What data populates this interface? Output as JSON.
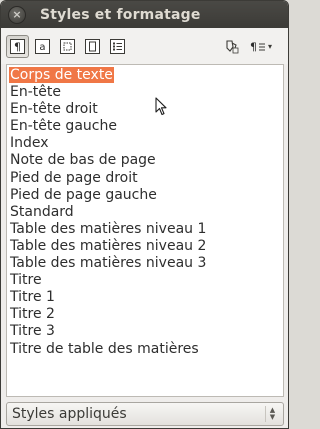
{
  "window": {
    "title": "Styles et formatage",
    "close_glyph": "×"
  },
  "toolbar": {
    "buttons": [
      {
        "icon": "paragraph-styles-icon",
        "active": true
      },
      {
        "icon": "character-styles-icon",
        "active": false
      },
      {
        "icon": "frame-styles-icon",
        "active": false
      },
      {
        "icon": "page-styles-icon",
        "active": false
      },
      {
        "icon": "list-styles-icon",
        "active": false
      }
    ],
    "fill_format_icon": "fill-format-mode-icon",
    "new_style_icon": "new-style-from-selection-icon",
    "dropdown_glyph": "▾"
  },
  "styles": {
    "selected_index": 0,
    "items": [
      "Corps de texte",
      "En-tête",
      "En-tête droit",
      "En-tête gauche",
      "Index",
      "Note de bas de page",
      "Pied de page droit",
      "Pied de page gauche",
      "Standard",
      "Table des matières niveau 1",
      "Table des matières niveau 2",
      "Table des matières niveau 3",
      "Titre",
      "Titre 1",
      "Titre 2",
      "Titre 3",
      "Titre de table des matières"
    ]
  },
  "filter": {
    "value": "Styles appliqués",
    "spin_up": "▲",
    "spin_down": "▼"
  },
  "colors": {
    "selection": "#f07746",
    "titlebar": "#3c3b37"
  }
}
